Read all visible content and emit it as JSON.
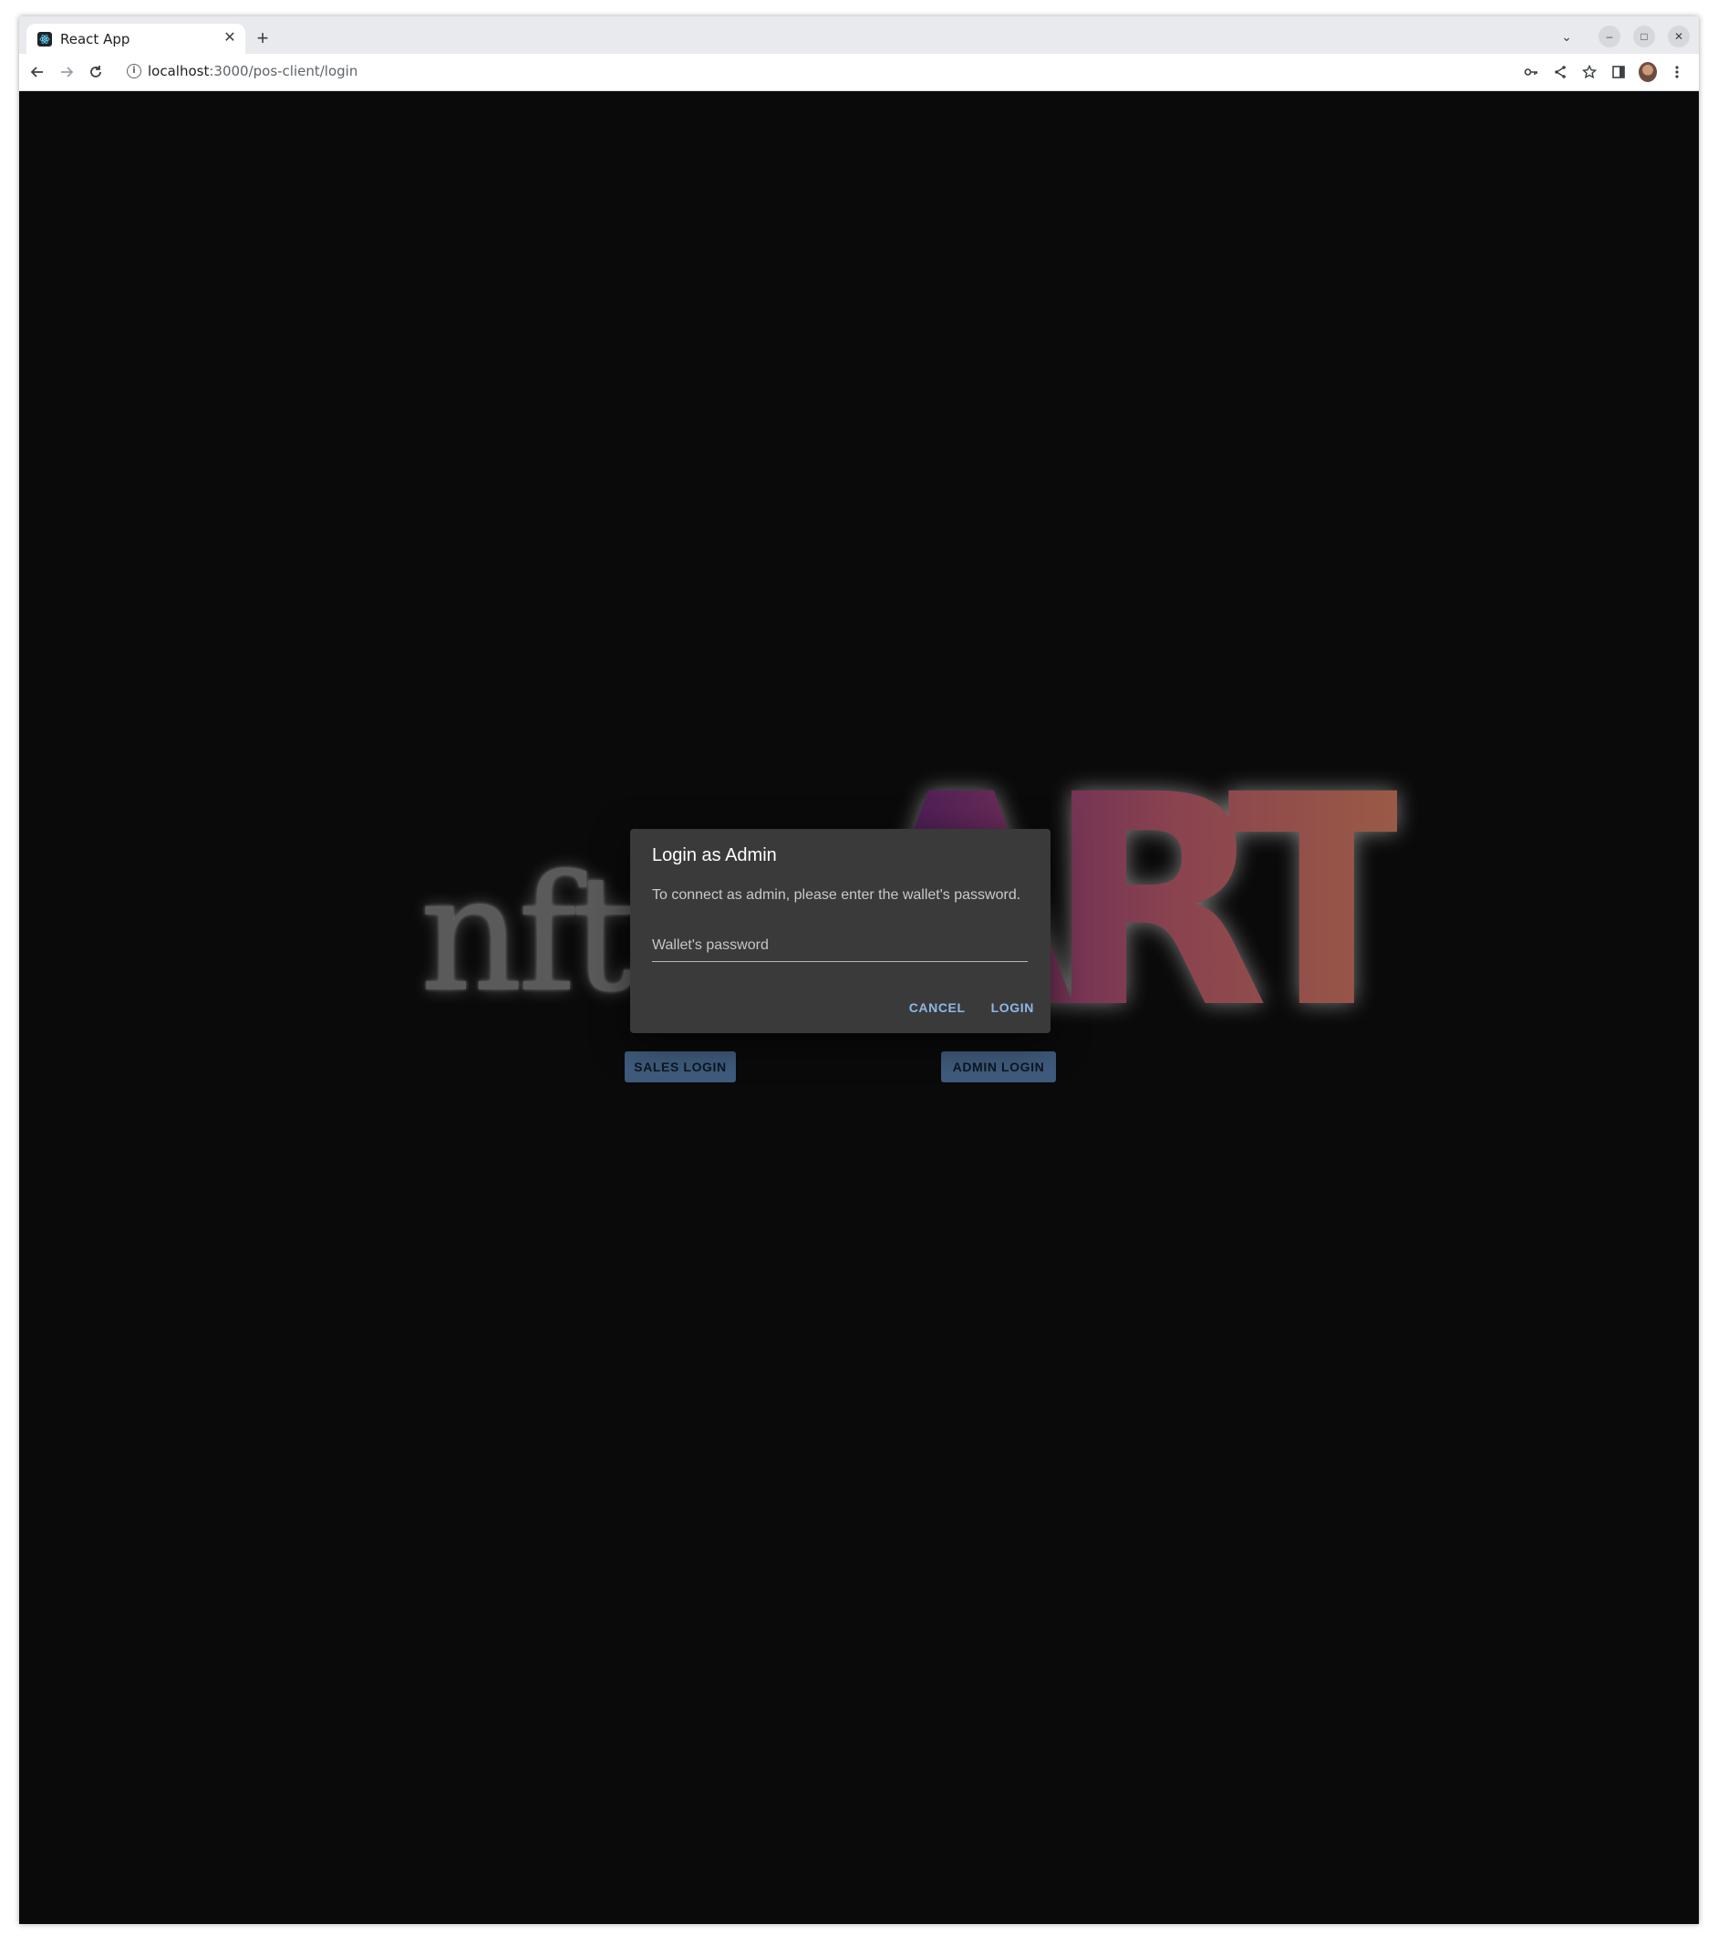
{
  "browser": {
    "tab_title": "React App",
    "url_host": "localhost",
    "url_path": ":3000/pos-client/login"
  },
  "logo": {
    "left_text": "nft",
    "right_text": "ART"
  },
  "buttons": {
    "sales_login": "SALES LOGIN",
    "admin_login": "ADMIN LOGIN"
  },
  "dialog": {
    "title": "Login as Admin",
    "message": "To connect as admin, please enter the wallet's password.",
    "password_placeholder": "Wallet's password",
    "password_value": "",
    "cancel_label": "CANCEL",
    "login_label": "LOGIN"
  },
  "colors": {
    "page_background": "#0a0a0b",
    "dialog_background": "#3a3a3b",
    "dialog_accent": "#8fb8e6",
    "login_button_background": "#3f5b7c"
  }
}
